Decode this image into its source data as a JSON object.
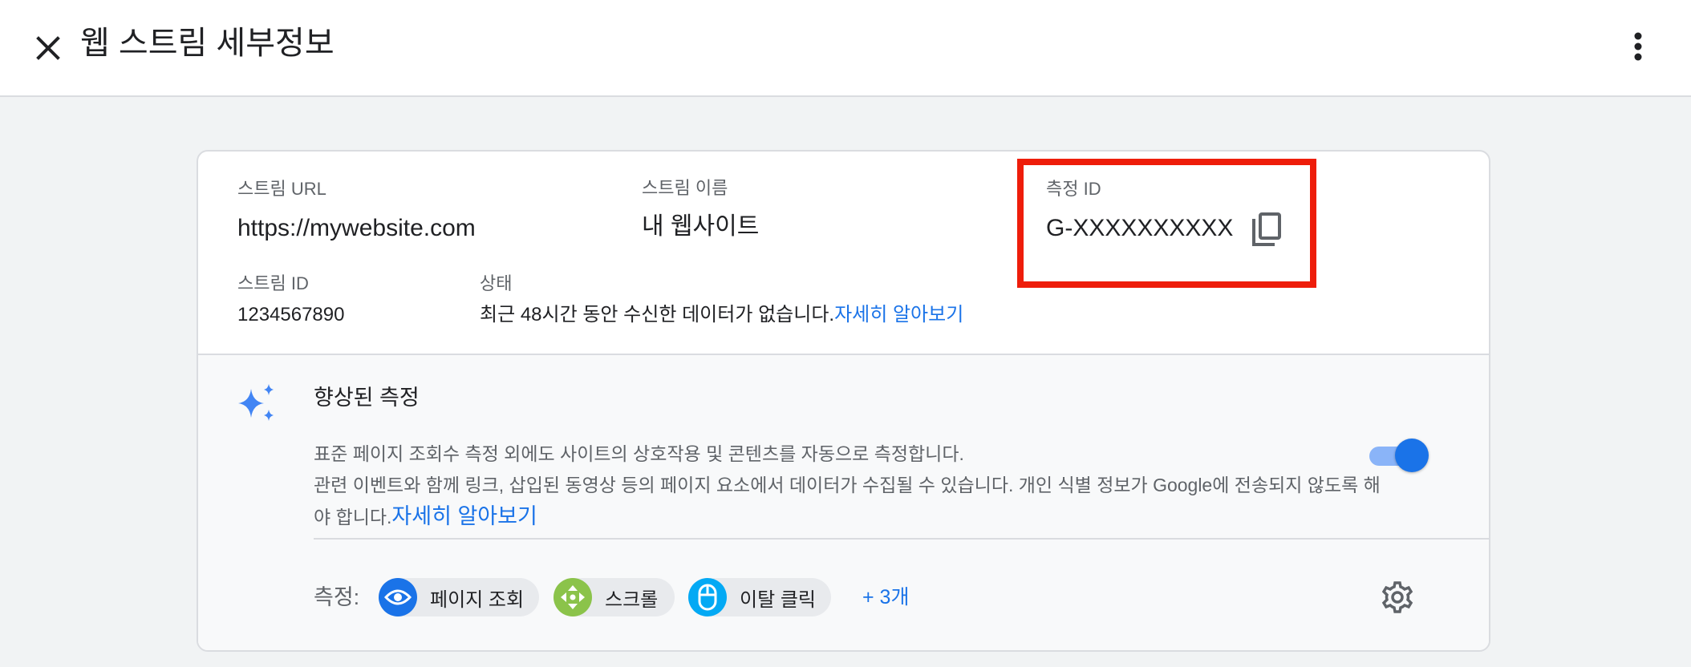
{
  "header": {
    "title": "웹 스트림 세부정보"
  },
  "stream": {
    "url_label": "스트림 URL",
    "url_value": "https://mywebsite.com",
    "name_label": "스트림 이름",
    "name_value": "내 웹사이트",
    "measurement_id_label": "측정 ID",
    "measurement_id_value": "G-XXXXXXXXXX",
    "stream_id_label": "스트림 ID",
    "stream_id_value": "1234567890",
    "status_label": "상태",
    "status_text": "최근 48시간 동안 수신한 데이터가 없습니다.",
    "status_link": "자세히 알아보기"
  },
  "enhanced": {
    "title": "향상된 측정",
    "description_line1": "표준 페이지 조회수 측정 외에도 사이트의 상호작용 및 콘텐츠를 자동으로 측정합니다.",
    "description_line2": "관련 이벤트와 함께 링크, 삽입된 동영상 등의 페이지 요소에서 데이터가 수집될 수 있습니다. 개인 식별 정보가 Google에 전송되지 않도록 해야 합니다.",
    "learn_more": "자세히 알아보기",
    "toggle_on": true,
    "measurements_label": "측정:",
    "chips": [
      {
        "label": "페이지 조회",
        "icon": "eye-icon",
        "color": "#1a73e8"
      },
      {
        "label": "스크롤",
        "icon": "scroll-arrows-icon",
        "color": "#8bc34a"
      },
      {
        "label": "이탈 클릭",
        "icon": "mouse-icon",
        "color": "#03a9f4"
      }
    ],
    "more_count": "+ 3개"
  },
  "colors": {
    "accent": "#1a73e8",
    "highlight": "#ee1d0a",
    "sparkle": "#4285f4"
  }
}
